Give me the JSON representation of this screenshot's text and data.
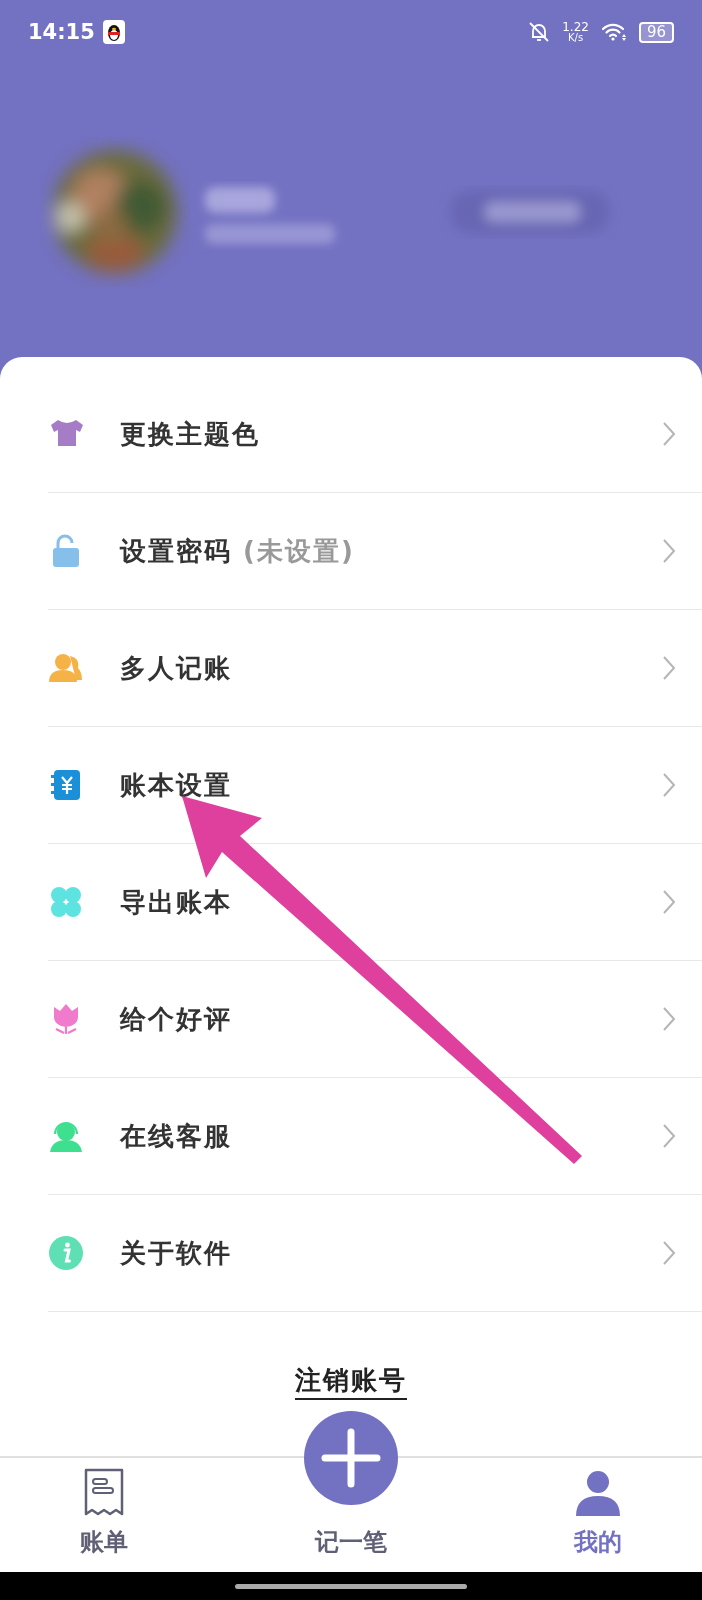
{
  "status_bar": {
    "time": "14:15",
    "net_speed": "1.22",
    "net_unit": "K/s",
    "battery": "96"
  },
  "menu": [
    {
      "label": "更换主题色"
    },
    {
      "label": "设置密码",
      "note": "(未设置)"
    },
    {
      "label": "多人记账"
    },
    {
      "label": "账本设置"
    },
    {
      "label": "导出账本"
    },
    {
      "label": "给个好评"
    },
    {
      "label": "在线客服"
    },
    {
      "label": "关于软件"
    }
  ],
  "logout_link": "注销账号",
  "tab_bar": [
    {
      "kind": "tab",
      "label": "账单",
      "selected": false
    },
    {
      "kind": "add",
      "label": "记一笔",
      "selected": false
    },
    {
      "kind": "tab",
      "label": "我的",
      "selected": true
    }
  ]
}
